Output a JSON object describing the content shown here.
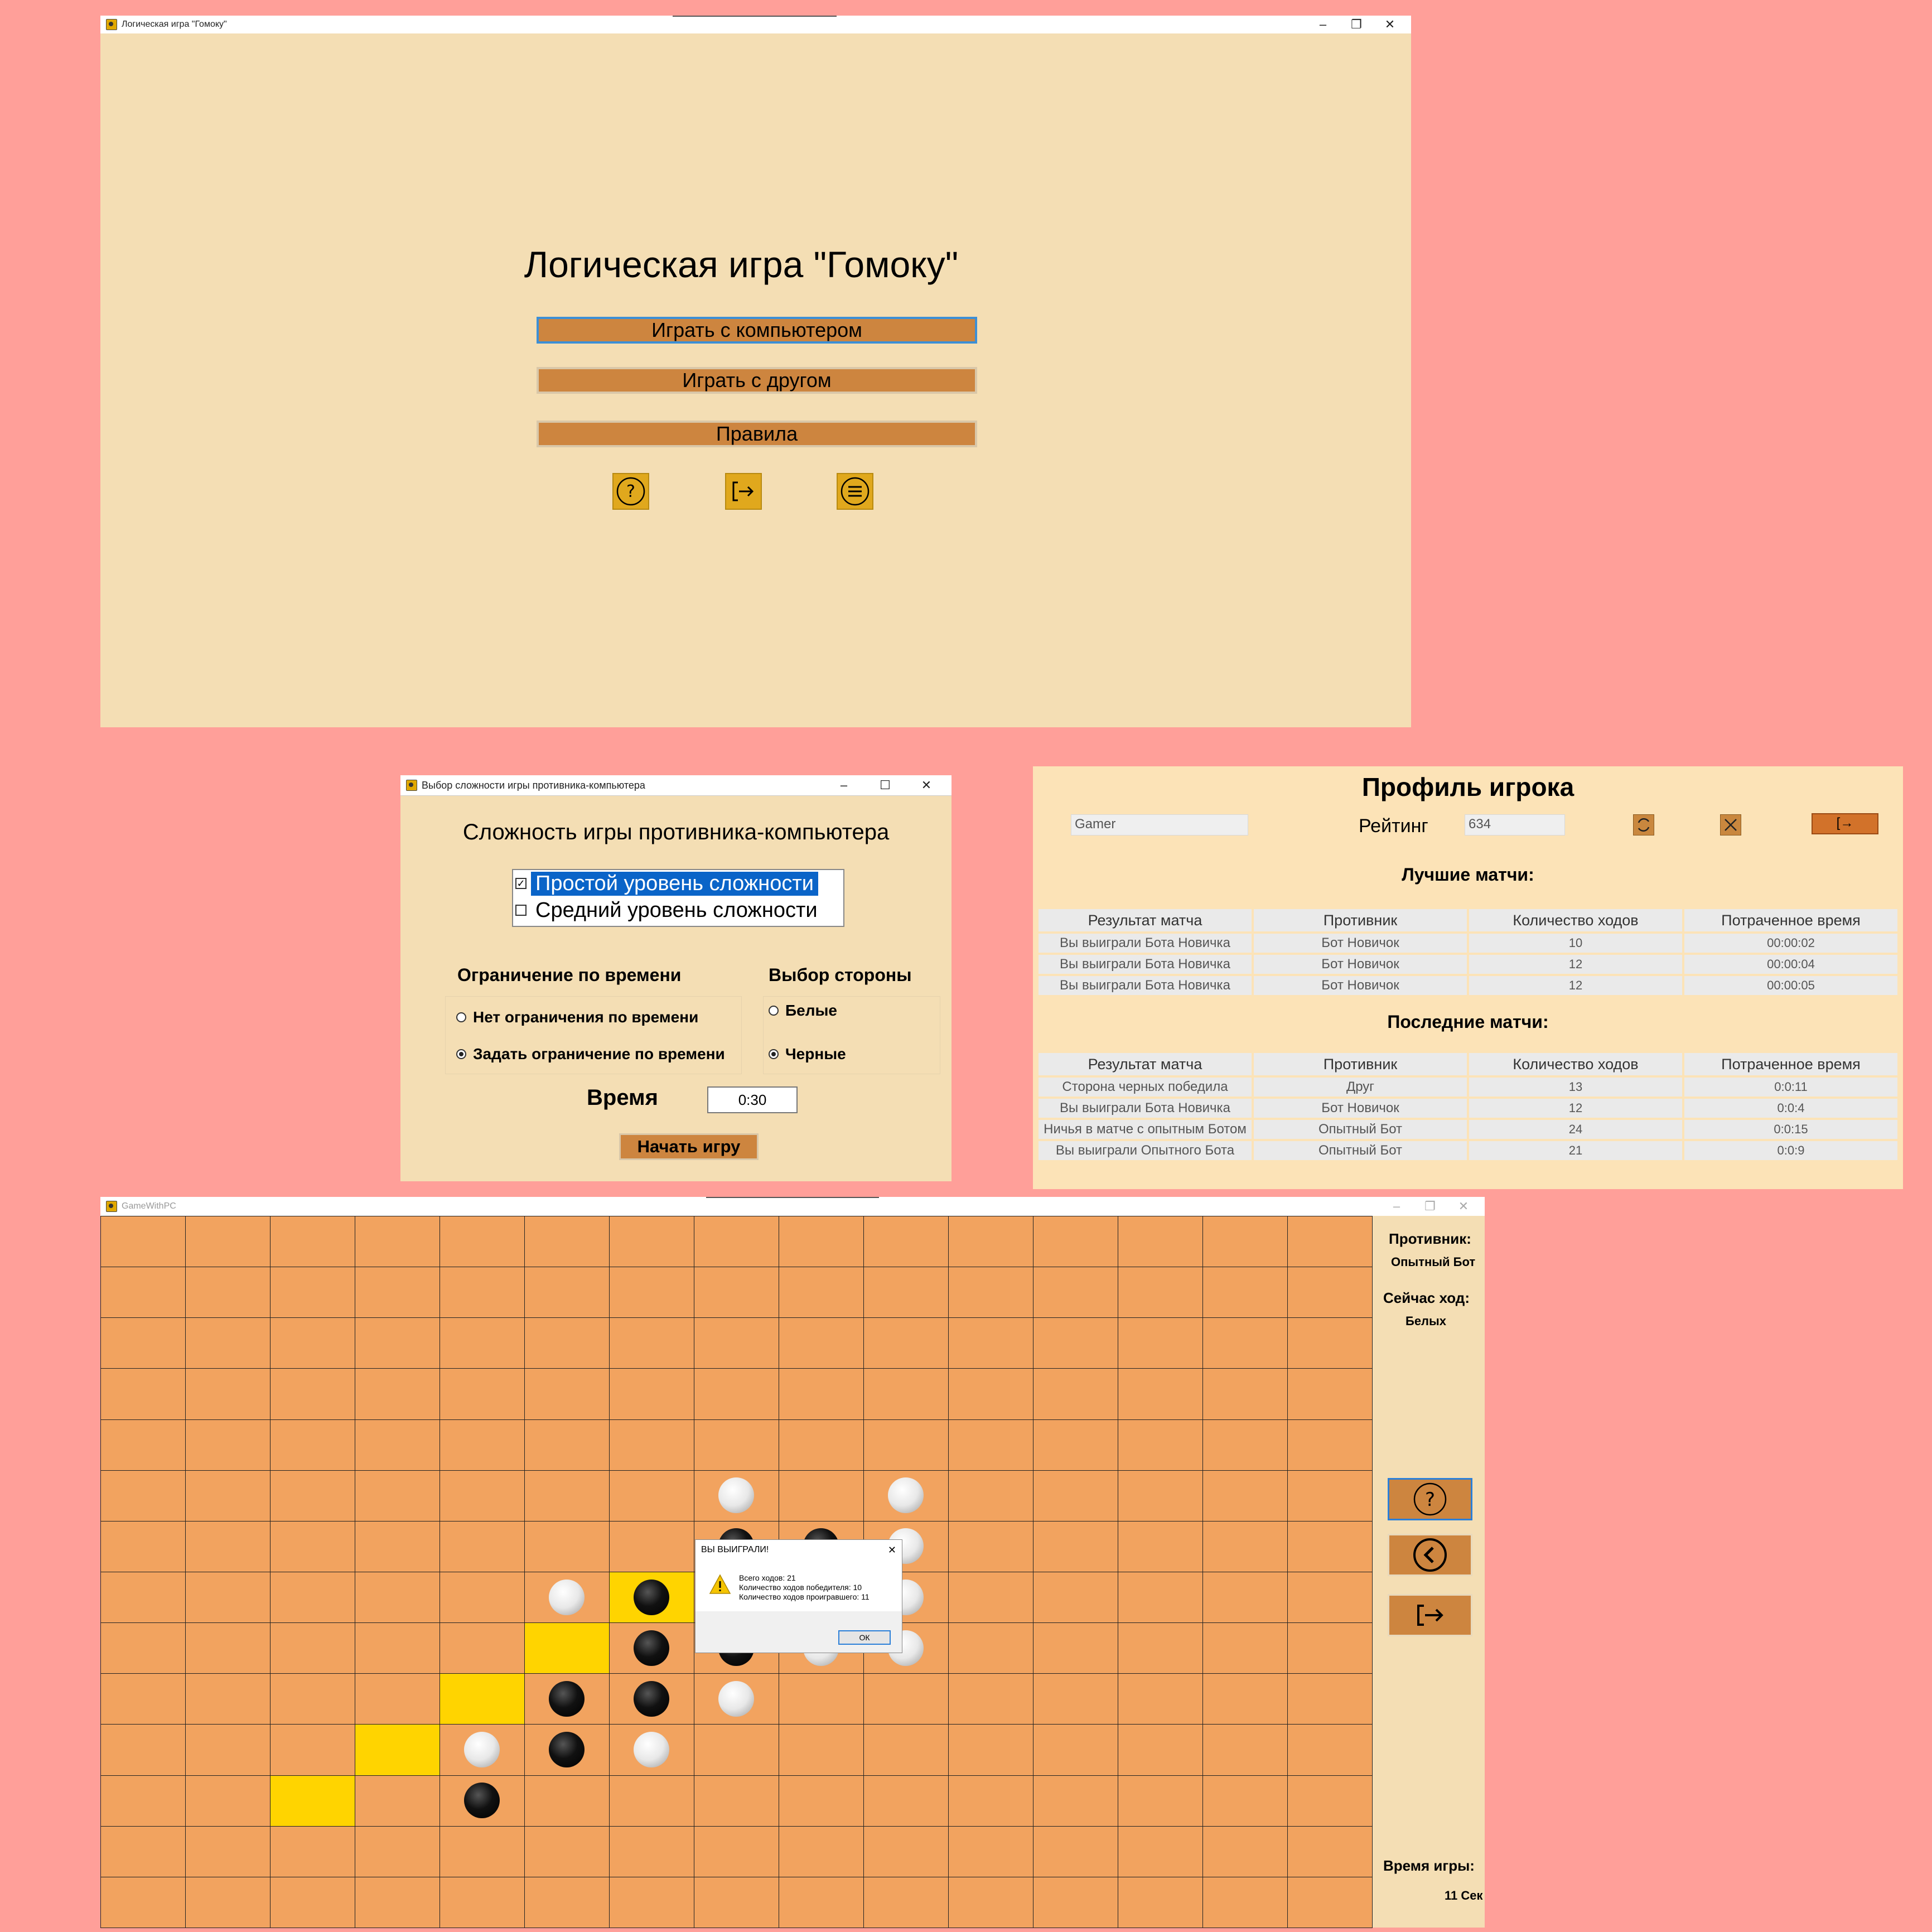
{
  "main_menu": {
    "window_title": "Логическая игра \"Гомоку\"",
    "heading": "Логическая игра \"Гомоку\"",
    "buttons": [
      "Играть с компьютером",
      "Играть с другом",
      "Правила"
    ],
    "icons": [
      "help-icon",
      "logout-icon",
      "menu-icon"
    ]
  },
  "difficulty": {
    "window_title": "Выбор сложности игры противника-компьютера",
    "heading": "Сложность игры противника-компьютера",
    "levels": [
      {
        "label": "Простой уровень сложности",
        "checked": true
      },
      {
        "label": "Средний уровень сложности",
        "checked": false
      }
    ],
    "time_limit_label": "Ограничение по времени",
    "time_options": [
      "Нет ограничения по времени",
      "Задать ограничение по времени"
    ],
    "time_selected": 1,
    "side_label": "Выбор стороны",
    "side_options": [
      "Белые",
      "Черные"
    ],
    "side_selected": 1,
    "time_field_label": "Время",
    "time_value": "0:30",
    "start_button": "Начать игру"
  },
  "profile": {
    "heading": "Профиль игрока",
    "username": "Gamer",
    "rating_label": "Рейтинг",
    "rating_value": "634",
    "best_heading": "Лучшие матчи:",
    "last_heading": "Последние матчи:",
    "columns": [
      "Результат матча",
      "Противник",
      "Количество ходов",
      "Потраченное время"
    ],
    "best_matches": [
      [
        "Вы выиграли Бота Новичка",
        "Бот Новичок",
        "10",
        "00:00:02"
      ],
      [
        "Вы выиграли Бота Новичка",
        "Бот Новичок",
        "12",
        "00:00:04"
      ],
      [
        "Вы выиграли Бота Новичка",
        "Бот Новичок",
        "12",
        "00:00:05"
      ]
    ],
    "last_matches": [
      [
        "Сторона черных победила",
        "Друг",
        "13",
        "0:0:11"
      ],
      [
        "Вы выиграли Бота Новичка",
        "Бот Новичок",
        "12",
        "0:0:4"
      ],
      [
        "Ничья в матче с опытным Ботом",
        "Опытный Бот",
        "24",
        "0:0:15"
      ],
      [
        "Вы выиграли Опытного Бота",
        "Опытный Бот",
        "21",
        "0:0:9"
      ]
    ]
  },
  "game": {
    "window_title": "GameWithPC",
    "opponent_label": "Противник:",
    "opponent_value": "Опытный Бот",
    "turn_label": "Сейчас ход:",
    "turn_value": "Белых",
    "time_label": "Время игры:",
    "time_value": "11 Сек",
    "board": {
      "cols": 15,
      "rows": 14,
      "highlighted": [
        [
          6,
          7
        ],
        [
          5,
          8
        ],
        [
          4,
          9
        ],
        [
          3,
          10
        ],
        [
          2,
          11
        ]
      ],
      "stones": [
        {
          "c": 7,
          "r": 5,
          "color": "white"
        },
        {
          "c": 9,
          "r": 5,
          "color": "white"
        },
        {
          "c": 7,
          "r": 6,
          "color": "black"
        },
        {
          "c": 8,
          "r": 6,
          "color": "black"
        },
        {
          "c": 9,
          "r": 6,
          "color": "white"
        },
        {
          "c": 5,
          "r": 7,
          "color": "white"
        },
        {
          "c": 6,
          "r": 7,
          "color": "black"
        },
        {
          "c": 9,
          "r": 7,
          "color": "white"
        },
        {
          "c": 6,
          "r": 8,
          "color": "black"
        },
        {
          "c": 7,
          "r": 8,
          "color": "black"
        },
        {
          "c": 8,
          "r": 8,
          "color": "white"
        },
        {
          "c": 9,
          "r": 8,
          "color": "white"
        },
        {
          "c": 5,
          "r": 9,
          "color": "black"
        },
        {
          "c": 6,
          "r": 9,
          "color": "black"
        },
        {
          "c": 7,
          "r": 9,
          "color": "white"
        },
        {
          "c": 4,
          "r": 10,
          "color": "white"
        },
        {
          "c": 5,
          "r": 10,
          "color": "black"
        },
        {
          "c": 6,
          "r": 10,
          "color": "white"
        },
        {
          "c": 4,
          "r": 11,
          "color": "black"
        }
      ]
    },
    "side_icons": [
      "help-icon",
      "back-icon",
      "logout-icon"
    ]
  },
  "dialog": {
    "title": "ВЫ ВЫИГРАЛИ!",
    "lines": [
      "Всего ходов: 21",
      "Количество ходов победителя: 10",
      "Количество ходов проигравшего: 11"
    ],
    "ok": "ОК"
  },
  "colors": {
    "background": "#ff9f99",
    "panel": "#f4deb4",
    "button": "#cd853f",
    "board": "#f2a35f",
    "highlight": "#ffd400"
  }
}
